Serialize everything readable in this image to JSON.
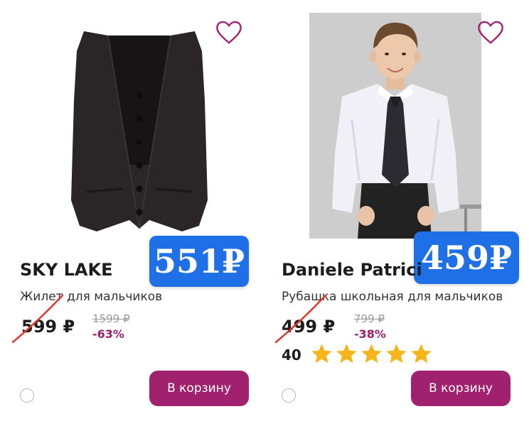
{
  "currency": "₽",
  "colors": {
    "accent": "#a0226e",
    "promo": "#1f6fe6",
    "discount": "#9a1f6e",
    "star": "#f7b51c",
    "strike": "#e0382e"
  },
  "products": [
    {
      "brand": "SKY LAKE",
      "description": "Жилет для мальчиков",
      "price": "599 ₽",
      "old_price": "1599 ₽",
      "discount": "-63%",
      "promo_price": "551₽",
      "cart_button": "В корзину",
      "favorite_icon": "heart-outline-icon",
      "image": "black-vest-photo"
    },
    {
      "brand": "Daniele Patrici",
      "description": "Рубашка школьная для мальчиков",
      "price": "499 ₽",
      "old_price": "799 ₽",
      "discount": "-38%",
      "promo_price": "459₽",
      "rating_count": "40",
      "rating_stars": 5,
      "cart_button": "В корзину",
      "favorite_icon": "heart-outline-icon",
      "image": "boy-white-shirt-photo"
    }
  ]
}
